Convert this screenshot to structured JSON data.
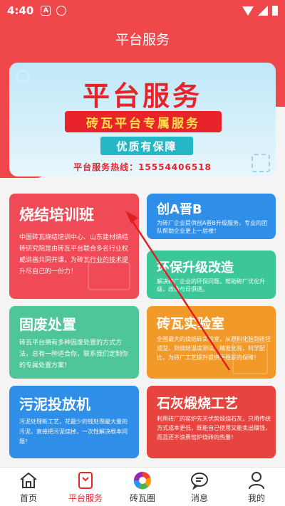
{
  "status_bar": {
    "time": "4:40",
    "icons": [
      "notification-a-icon",
      "shield-icon",
      "wifi-icon",
      "signal-icon",
      "battery-icon"
    ],
    "notif_a": "A"
  },
  "header": {
    "title": "平台服务"
  },
  "banner": {
    "title": "平台服务",
    "subtitle": "砖瓦平台专属服务",
    "tag": "优质有保障",
    "hotline": "平台服务热线：15554406518"
  },
  "cards": {
    "sj": {
      "title": "烧结培训班",
      "desc": "中国砖瓦烧结培训中心、山东建材烧结砖研究院是由砖瓦平台联合多名行业权威讲画共同开课，为砖瓦行业的技术提升尽自己的一份力！"
    },
    "ca": {
      "title": "创A晋B",
      "desc": "为砖厂企业提供创A晋B升级服务，专业的团队帮助企业更上一层楼！"
    },
    "hb": {
      "title": "环保升级改造",
      "desc": "解决砖厂企业的环保问题，帮助砖厂优化升级，改造与日俱进。"
    },
    "gf": {
      "title": "固废处置",
      "desc": "砖瓦平台拥有多种固废处置的方式方法，总有一种适合你，联系我们定制你的专属处置方案！"
    },
    "zw": {
      "title": "砖瓦实验室",
      "desc": "全国最大的烧结砖实验室，从原料化验到砖坯成型，到烧结温度测试，精准化验，科学配比，为砖厂工艺提升提供更稳妥的保障！"
    },
    "wn": {
      "title": "污泥投放机",
      "desc": "污泥处理新工艺，花最少的钱处理最大量的污泥，直接把污泥烧掉，一次性解决根本问题！"
    },
    "sh": {
      "title": "石灰煅烧工艺",
      "desc": "利用砖厂的窑炉先天优势煅烧石灰，只用传统方式成本更低，既能自己使用又能卖出赚钱，而且还不浪费窑炉烧砖的热量！"
    }
  },
  "tabs": [
    {
      "label": "首页",
      "icon": "home-icon"
    },
    {
      "label": "平台服务",
      "icon": "service-icon",
      "active": true
    },
    {
      "label": "砖瓦圈",
      "icon": "circle-icon"
    },
    {
      "label": "消息",
      "icon": "message-icon"
    },
    {
      "label": "我的",
      "icon": "profile-icon"
    }
  ],
  "colors": {
    "primary_red": "#f0484a",
    "accent_red": "#e8242a",
    "blue": "#2f8ee8",
    "green": "#3cc79a",
    "orange": "#f19a2a"
  }
}
